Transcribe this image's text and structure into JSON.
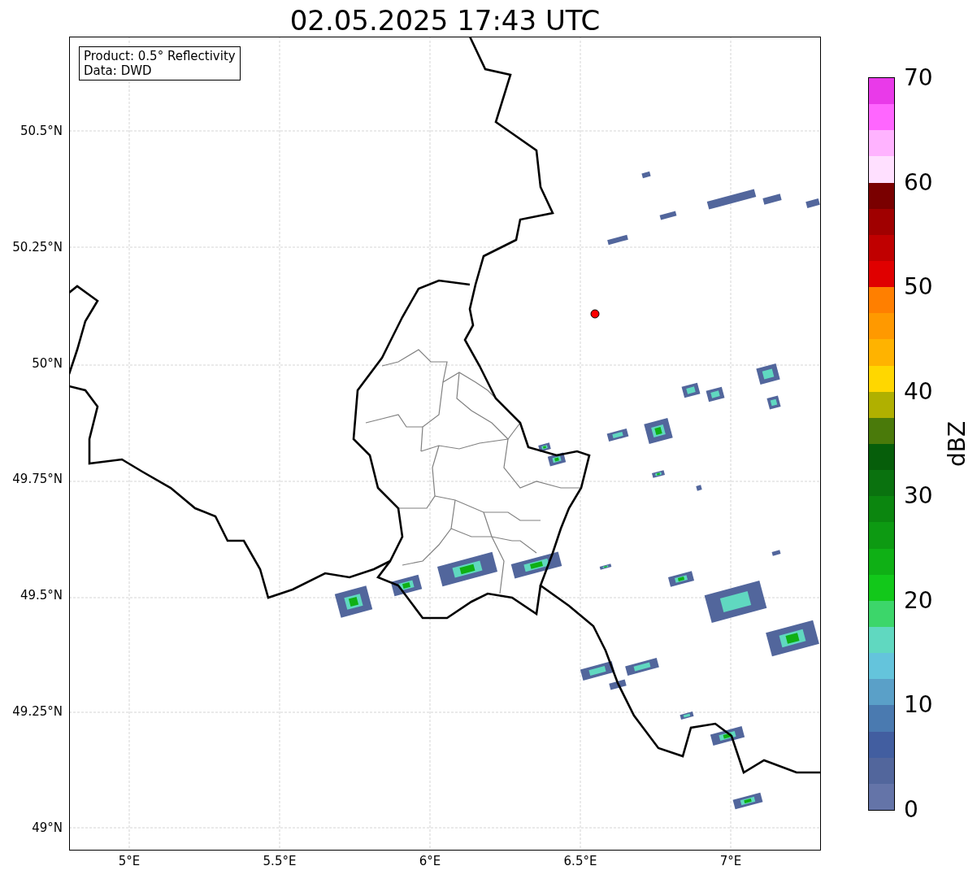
{
  "title": "02.05.2025 17:43 UTC",
  "info_box": [
    "Product: 0.5° Reflectivity",
    "Data: DWD"
  ],
  "map": {
    "lat_ticks": [
      "50.5°N",
      "50.25°N",
      "50°N",
      "49.75°N",
      "49.5°N",
      "49.25°N",
      "49°N"
    ],
    "lon_ticks": [
      "5°E",
      "5.5°E",
      "6°E",
      "6.5°E",
      "7°E"
    ]
  },
  "colorbar": {
    "label": "dBZ",
    "ticks": [
      "70",
      "60",
      "50",
      "40",
      "30",
      "20",
      "10",
      "0"
    ],
    "bins": [
      {
        "color": "#e93ae9"
      },
      {
        "color": "#ff66ff"
      },
      {
        "color": "#ffb3ff"
      },
      {
        "color": "#ffe0ff"
      },
      {
        "color": "#7a0000"
      },
      {
        "color": "#a00000"
      },
      {
        "color": "#c00000"
      },
      {
        "color": "#e00000"
      },
      {
        "color": "#ff7f00"
      },
      {
        "color": "#ff9900"
      },
      {
        "color": "#ffb300"
      },
      {
        "color": "#ffd700"
      },
      {
        "color": "#b0b000"
      },
      {
        "color": "#4a7a0a"
      },
      {
        "color": "#065e0a"
      },
      {
        "color": "#0a720f"
      },
      {
        "color": "#0b860f"
      },
      {
        "color": "#0d9a12"
      },
      {
        "color": "#0fb015"
      },
      {
        "color": "#12c81a"
      },
      {
        "color": "#3cd66a"
      },
      {
        "color": "#60d8c0"
      },
      {
        "color": "#64c4dc"
      },
      {
        "color": "#5aa0c8"
      },
      {
        "color": "#4a7ab0"
      },
      {
        "color": "#425ea0"
      },
      {
        "color": "#52669c"
      },
      {
        "color": "#6474a8"
      }
    ]
  }
}
